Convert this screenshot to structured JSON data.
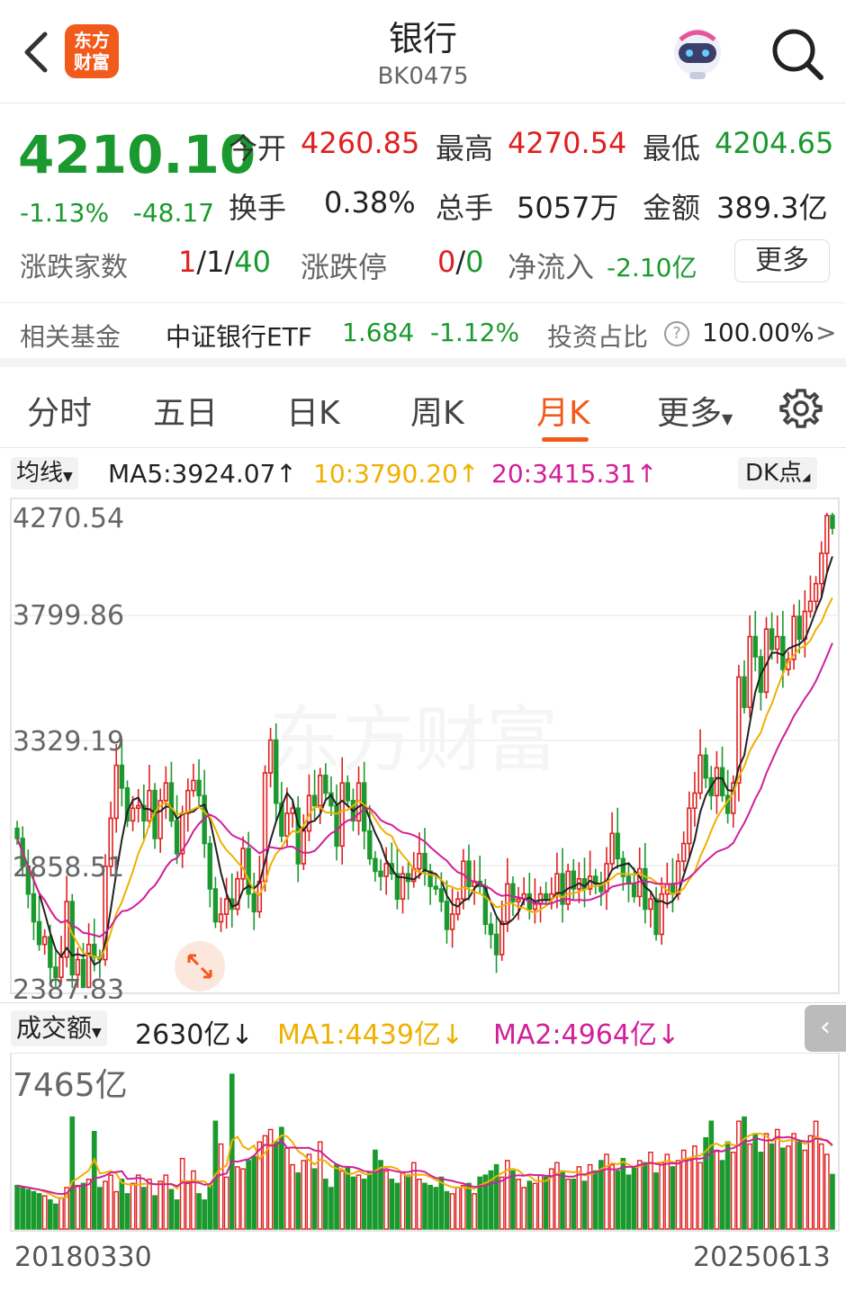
{
  "header": {
    "title": "银行",
    "code": "BK0475",
    "logo_text_1": "东方",
    "logo_text_2": "财富"
  },
  "quote": {
    "price": "4210.10",
    "pct": "-1.13%",
    "change": "-48.17",
    "open_label": "今开",
    "open": "4260.85",
    "high_label": "最高",
    "high": "4270.54",
    "low_label": "最低",
    "low": "4204.65",
    "turnover_label": "换手",
    "turnover": "0.38%",
    "volume_label": "总手",
    "volume": "5057万",
    "amount_label": "金额",
    "amount": "389.3亿",
    "updown_label": "涨跌家数",
    "up": "1",
    "flat": "1",
    "down": "40",
    "limit_label": "涨跌停",
    "limit_up": "0",
    "limit_down": "0",
    "netflow_label": "净流入",
    "netflow": "-2.10亿",
    "more_label": "更多"
  },
  "fund": {
    "label": "相关基金",
    "name": "中证银行ETF",
    "price": "1.684",
    "pct": "-1.12%",
    "ratio_label": "投资占比",
    "help_icon": "?",
    "ratio": "100.00%",
    "arrow": ">"
  },
  "tabs": [
    "分时",
    "五日",
    "日K",
    "周K",
    "月K",
    "更多"
  ],
  "active_tab": "月K",
  "ma": {
    "selector": "均线",
    "ma5": "MA5:3924.07",
    "ma10": "10:3790.20",
    "ma20": "20:3415.31",
    "up_arrow": "↑",
    "dk": "DK点"
  },
  "chart_labels": {
    "y1": "4270.54",
    "y2": "3799.86",
    "y3": "3329.19",
    "y4": "2858.51",
    "y5": "2387.83",
    "watermark": "东方财富"
  },
  "volume": {
    "selector": "成交额",
    "current": "2630亿",
    "ma1": "MA1:4439亿",
    "ma2": "MA2:4964亿",
    "down_arrow": "↓",
    "max": "7465亿"
  },
  "dates": {
    "start": "20180330",
    "end": "20250613"
  },
  "colors": {
    "up": "#e02020",
    "down": "#1a9a2e",
    "ma5": "#222222",
    "ma10": "#f0b000",
    "ma20": "#d0209a",
    "accent": "#f25a1c"
  },
  "chart_data": {
    "type": "candlestick",
    "period": "monthly",
    "x_start": "20180330",
    "x_end": "20250613",
    "ylim": [
      2387.83,
      4270.54
    ],
    "closes": [
      2980,
      2870,
      2760,
      2650,
      2560,
      2590,
      2470,
      2430,
      2510,
      2730,
      2440,
      2500,
      2390,
      2560,
      2510,
      2500,
      2870,
      3060,
      3270,
      3180,
      3050,
      3100,
      3110,
      3050,
      3170,
      2980,
      3130,
      3200,
      3050,
      2920,
      3080,
      3170,
      3210,
      3150,
      2960,
      2780,
      2650,
      2680,
      2740,
      2700,
      2820,
      2940,
      2760,
      2690,
      2810,
      3240,
      3370,
      3120,
      2990,
      3080,
      3100,
      2880,
      3010,
      3150,
      3110,
      3230,
      3160,
      3110,
      2950,
      3200,
      3130,
      3050,
      3200,
      3010,
      2900,
      2850,
      2830,
      2880,
      2840,
      2740,
      2840,
      2810,
      2860,
      2920,
      2850,
      2790,
      2780,
      2730,
      2620,
      2680,
      2740,
      2890,
      2790,
      2810,
      2790,
      2640,
      2600,
      2520,
      2650,
      2800,
      2730,
      2740,
      2760,
      2700,
      2720,
      2760,
      2740,
      2760,
      2840,
      2720,
      2850,
      2780,
      2820,
      2780,
      2830,
      2800,
      2770,
      2880,
      3000,
      2900,
      2830,
      2800,
      2750,
      2860,
      2700,
      2740,
      2600,
      2760,
      2800,
      2760,
      2890,
      2960,
      3100,
      3160,
      3310,
      3220,
      3150,
      3260,
      3150,
      3080,
      3200,
      3620,
      3500,
      3780,
      3700,
      3560,
      3810,
      3730,
      3780,
      3650,
      3690,
      3860,
      3770,
      3880,
      3920,
      3990,
      4110,
      4260,
      4210
    ],
    "ma5_last": 3924.07,
    "ma10_last": 3790.2,
    "ma20_last": 3415.31,
    "volume_unit": "亿",
    "volume_max": 7465,
    "volume_last": 2630,
    "vol_ma1_last": 4439,
    "vol_ma2_last": 4964,
    "volumes": [
      2100,
      2000,
      1900,
      1800,
      1700,
      1600,
      1400,
      1200,
      1500,
      2000,
      5400,
      2100,
      2200,
      2400,
      4700,
      2000,
      2300,
      2600,
      1800,
      2400,
      1700,
      2200,
      2600,
      2000,
      2400,
      1600,
      2300,
      2600,
      1900,
      1400,
      3400,
      2200,
      2800,
      1700,
      1400,
      2100,
      5200,
      4100,
      2500,
      7465,
      3000,
      2900,
      3300,
      3500,
      4200,
      4500,
      4800,
      4200,
      4900,
      3900,
      3100,
      2700,
      3300,
      3600,
      2900,
      4200,
      2400,
      2000,
      3100,
      2800,
      3000,
      2500,
      2600,
      2400,
      2700,
      3800,
      3300,
      2800,
      2400,
      2200,
      2700,
      2600,
      3200,
      2400,
      2200,
      2100,
      2000,
      2500,
      1800,
      1700,
      2000,
      2100,
      2200,
      1700,
      2500,
      2600,
      2800,
      3100,
      2500,
      3300,
      2800,
      2400,
      2000,
      2300,
      2200,
      2600,
      2500,
      2900,
      3200,
      2800,
      2400,
      2400,
      3000,
      2300,
      3100,
      2800,
      3300,
      3600,
      3100,
      2800,
      3400,
      2600,
      3000,
      3300,
      3200,
      3700,
      2700,
      3200,
      3600,
      3000,
      3300,
      3800,
      3400,
      4000,
      3200,
      4400,
      5200,
      3800,
      3300,
      4200,
      3700,
      5200,
      5400,
      4100,
      4600,
      3700,
      4600,
      4100,
      4800,
      3900,
      4000,
      4600,
      4200,
      3800,
      4500,
      5200,
      4100,
      3600,
      2630
    ]
  }
}
